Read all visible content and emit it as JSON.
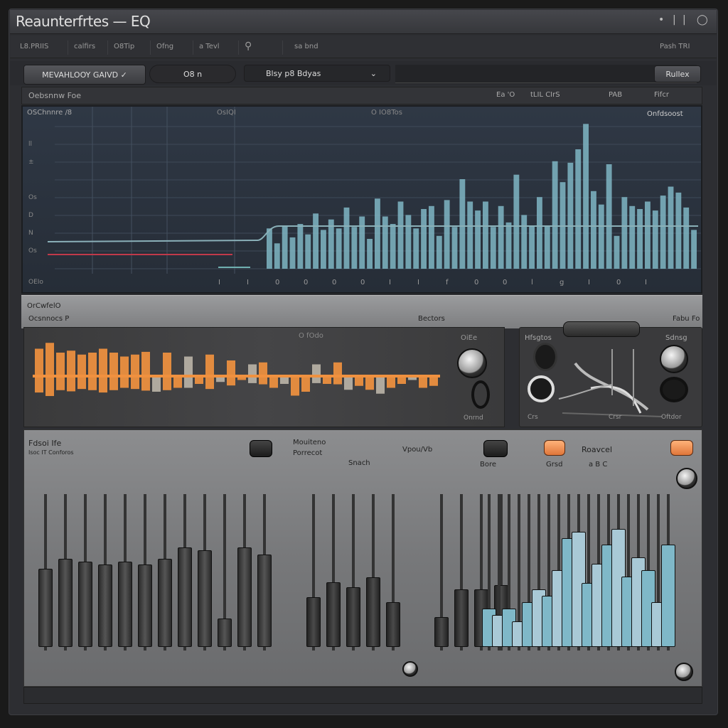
{
  "window": {
    "title": "Reaunterfrtes — EQ",
    "controls": [
      "•",
      "|",
      "|",
      "◯"
    ]
  },
  "menu": {
    "items": [
      "L8.PRIIS",
      "calfirs",
      "O8Tip",
      "Ofng",
      "a Tevl"
    ],
    "search_icon": "search-icon",
    "field_text": "sa bnd",
    "right_text": "Pash TRI"
  },
  "toolbar": {
    "preset_button": "MEVAHLOOY GAIVD ✓",
    "pill_text": "O8 n",
    "dropdown": {
      "value": "Blsy  p8    Bdyas"
    },
    "right_button": "Rullex"
  },
  "header": {
    "left": "Oebsnnw Foe",
    "right_items": [
      "Ea 'O",
      "tLIL CIrS",
      "PAB",
      "Fifcr"
    ]
  },
  "spectrum": {
    "title": "OSChnnre /8",
    "top_label": "OsIQI",
    "center_label": "O  IO8Tos",
    "right_label": "Onfdsoost",
    "y_labels": [
      "",
      "ll",
      "±",
      "",
      "Os",
      "D",
      "N",
      "Os"
    ],
    "x_labels": [
      "I",
      "I",
      "0",
      "0",
      "0",
      "0",
      "I",
      "I",
      "f",
      "0",
      "0",
      "l",
      "g",
      "I",
      "0",
      "I"
    ],
    "bottom_left": "OEIo",
    "levels": [
      0.27,
      0.17,
      0.29,
      0.21,
      0.3,
      0.23,
      0.37,
      0.26,
      0.33,
      0.27,
      0.41,
      0.28,
      0.35,
      0.2,
      0.47,
      0.35,
      0.3,
      0.45,
      0.36,
      0.27,
      0.4,
      0.42,
      0.22,
      0.46,
      0.28,
      0.6,
      0.45,
      0.39,
      0.45,
      0.28,
      0.42,
      0.31,
      0.63,
      0.36,
      0.29,
      0.48,
      0.29,
      0.72,
      0.58,
      0.71,
      0.8,
      0.97,
      0.52,
      0.43,
      0.7,
      0.22,
      0.48,
      0.42,
      0.4,
      0.45,
      0.39,
      0.49,
      0.55,
      0.51,
      0.41,
      0.26
    ],
    "colors": {
      "bars": "#7fb6c4",
      "curve": "#8ab0b8",
      "low_line": "#c0394a"
    }
  },
  "band": {
    "left_top": "OrCwfelO",
    "left_sub": "Ocsnnocs P",
    "center": "Bectors",
    "right": "Fabu Fo"
  },
  "wave": {
    "label": "O fOdo",
    "knob_label": "OiEe",
    "small": "Onrnd",
    "values": [
      0.7,
      0.85,
      0.6,
      0.65,
      0.55,
      0.6,
      0.7,
      0.6,
      0.5,
      0.55,
      0.62,
      -0.4,
      0.6,
      -0.3,
      0.5,
      -0.2,
      0.55,
      -0.15,
      0.4,
      -0.1,
      0.3,
      0.35,
      -0.3,
      -0.2,
      -0.5,
      -0.4,
      0.3,
      -0.2,
      0.35,
      -0.35,
      -0.25,
      -0.35,
      -0.45,
      -0.3,
      -0.2,
      -0.1,
      -0.3,
      -0.25
    ],
    "color": "#f0913f"
  },
  "fx": {
    "label": "Hfsgtos",
    "right_label": "Sdnsg",
    "bottom_left": "Crs",
    "bottom_center": "Crsr",
    "bottom_right": "Oftdor"
  },
  "mixer": {
    "left_title": "Fdsoi Ife",
    "left_sub": "Isoc IT Conforos",
    "mid_title": "Mouiteno",
    "mid_sub": "Porrecot",
    "search_label": "Snach",
    "vol_label": "Vpou/Vb",
    "bore_label": "Bore",
    "grad_label": "Grsd",
    "rightTitle": "Roavcel",
    "right_sub": "a B C",
    "gray_faders": [
      0.55,
      0.62,
      0.6,
      0.58,
      0.6,
      0.58,
      0.62,
      0.7,
      0.68,
      0.2,
      0.7,
      0.65
    ],
    "mid_faders": [
      0.5,
      0.65,
      0.6,
      0.7,
      0.45,
      0.3,
      0.58,
      0.58,
      0.62
    ],
    "blue_faders": [
      0.3,
      0.25,
      0.3,
      0.2,
      0.35,
      0.45,
      0.4,
      0.6,
      0.85,
      0.9,
      0.5,
      0.65,
      0.8,
      0.92,
      0.55,
      0.7,
      0.6,
      0.35,
      0.8
    ]
  },
  "footer": {
    "segments": [
      "",
      "",
      "",
      "",
      "",
      "",
      ""
    ]
  }
}
